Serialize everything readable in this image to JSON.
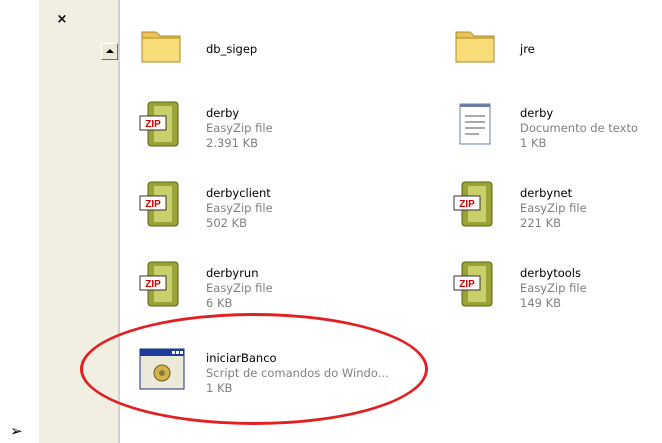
{
  "bullet_char": "➢",
  "pane": {
    "close_glyph": "×"
  },
  "files": [
    {
      "name": "db_sigep",
      "type": "",
      "size": "",
      "icon": "folder-icon"
    },
    {
      "name": "jre",
      "type": "",
      "size": "",
      "icon": "folder-icon"
    },
    {
      "name": "derby",
      "type": "EasyZip file",
      "size": "2.391 KB",
      "icon": "zip-icon"
    },
    {
      "name": "derby",
      "type": "Documento de texto",
      "size": "1 KB",
      "icon": "text-document-icon"
    },
    {
      "name": "derbyclient",
      "type": "EasyZip file",
      "size": "502 KB",
      "icon": "zip-icon"
    },
    {
      "name": "derbynet",
      "type": "EasyZip file",
      "size": "221 KB",
      "icon": "zip-icon"
    },
    {
      "name": "derbyrun",
      "type": "EasyZip file",
      "size": "6 KB",
      "icon": "zip-icon"
    },
    {
      "name": "derbytools",
      "type": "EasyZip file",
      "size": "149 KB",
      "icon": "zip-icon"
    },
    {
      "name": "iniciarBanco",
      "type": "Script de comandos do Windo...",
      "size": "1 KB",
      "icon": "batch-script-icon"
    }
  ],
  "colors": {
    "highlight_circle": "#e32021",
    "pane_bg": "#f1efe2",
    "zip_label": "#cc0000"
  }
}
